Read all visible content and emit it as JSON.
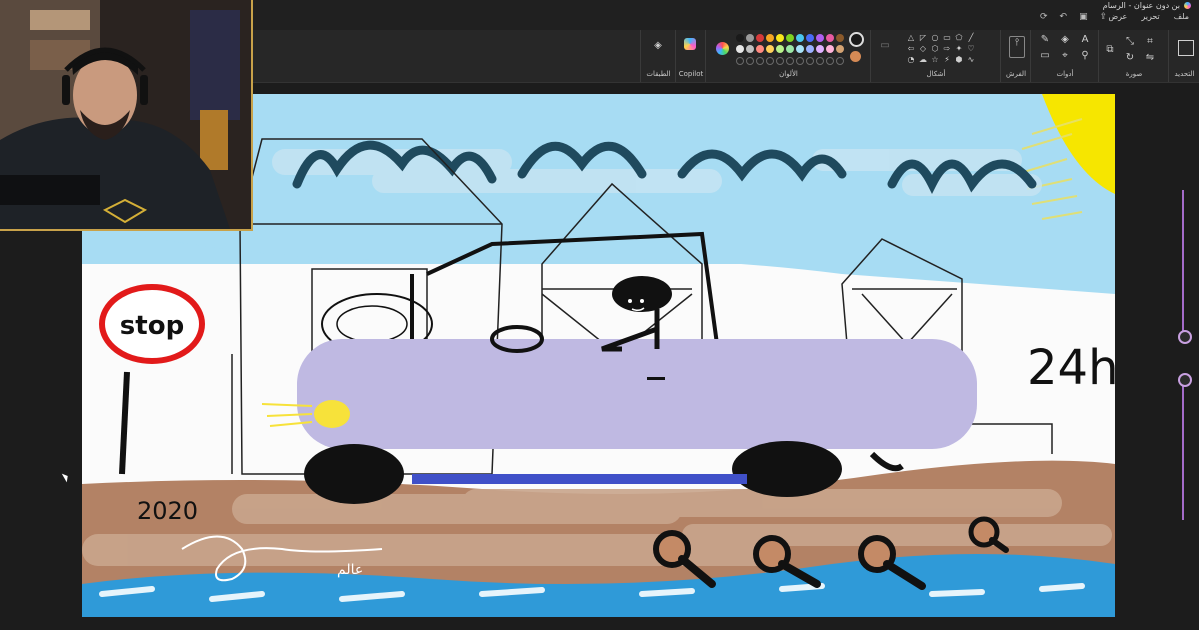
{
  "window": {
    "title": "بن دون عنوان - الرسام"
  },
  "menu": {
    "file": "ملف",
    "edit": "تحرير",
    "view": "عرض"
  },
  "ribbon": {
    "selection_label": "التحديد",
    "image_label": "صورة",
    "tools_label": "أدوات",
    "brushes_label": "الفرش",
    "shapes_label": "أشكال",
    "colors_label": "الألوان",
    "copilot_label": "Copilot",
    "layers_label": "الطبقات"
  },
  "colors": {
    "palette": [
      "#1a1a1a",
      "#e6e6e6",
      "#9b9b9b",
      "#c0c0c0",
      "#d63a3a",
      "#ff8a80",
      "#f5a623",
      "#ffd05a",
      "#f8e71c",
      "#b8f28a",
      "#7ed321",
      "#9be7a5",
      "#4ac7f0",
      "#a7e2f7",
      "#4a6cf7",
      "#9bb0ff",
      "#b05ff0",
      "#e0b0ff",
      "#e85aa0",
      "#ffb3d9",
      "#8b5a2b",
      "#d4a373"
    ],
    "primary": "#1a1a1a",
    "secondary": "#d58a55"
  },
  "drawing": {
    "stop_text": "stop",
    "year_text": "2020",
    "hours_text": "24h",
    "signature_text": "عالم"
  }
}
